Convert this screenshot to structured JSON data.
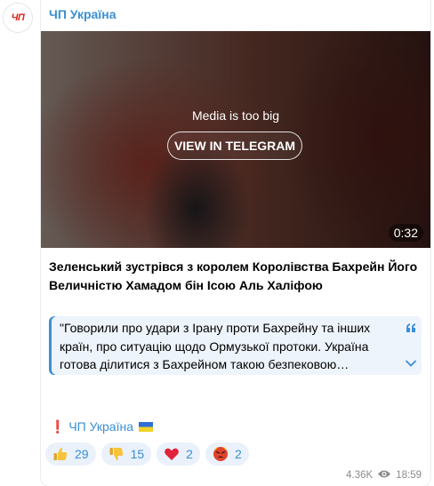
{
  "channel": {
    "avatar_text": "ЧП",
    "name": "ЧП Україна"
  },
  "media": {
    "note": "Media is too big",
    "button_label": "VIEW IN TELEGRAM",
    "duration": "0:32"
  },
  "post": {
    "headline": "Зеленський зустрівся з королем Королівства Бахрейн Його Величністю Хамадом бін Ісою Аль Халіфою",
    "quote": "\"Говорили про удари з Ірану проти Бахрейну та інших країн, про ситуацію щодо Ормузької протоки. Україна готова ділитися з Бахрейном такою безпековою…",
    "signature_mark": "❗",
    "signature": "ЧП Україна"
  },
  "reactions": [
    {
      "emoji": "thumbs-up",
      "count": "29"
    },
    {
      "emoji": "thumbs-down",
      "count": "15"
    },
    {
      "emoji": "red-heart",
      "count": "2"
    },
    {
      "emoji": "angry-face",
      "count": "2"
    }
  ],
  "meta": {
    "views": "4.36K",
    "time": "18:59"
  },
  "colors": {
    "accent": "#3a8fd4",
    "avatar_red": "#d9261c",
    "quote_bg": "#eef4fb",
    "reaction_bg": "#eaf1fa"
  }
}
